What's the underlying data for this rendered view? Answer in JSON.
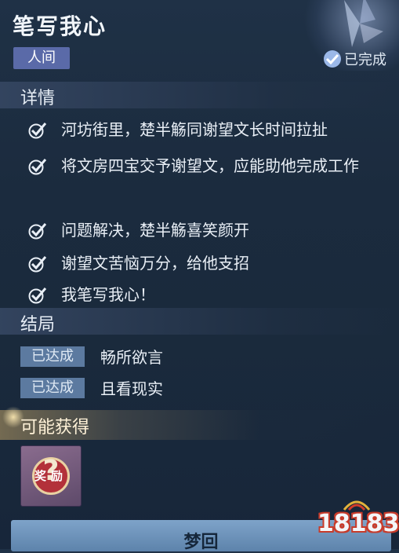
{
  "header": {
    "title": "笔写我心",
    "tag": "人间",
    "status": "已完成"
  },
  "details": {
    "heading": "详情",
    "items": [
      "河坊街里，楚半觞同谢望文长时间拉扯",
      "将文房四宝交予谢望文，应能助他完成工作",
      "问题解决，楚半觞喜笑颜开",
      "谢望文苦恼万分，给他支招",
      "我笔写我心！"
    ]
  },
  "endings": {
    "heading": "结局",
    "items": [
      {
        "badge": "已达成",
        "label": "畅所欲言"
      },
      {
        "badge": "已达成",
        "label": "且看现实"
      }
    ]
  },
  "rewards": {
    "heading": "可能获得",
    "item_label": "奖励",
    "item_icon": "question-mark"
  },
  "footer_button": "梦回",
  "watermark": "18183",
  "colors": {
    "tag_bg": "#5a6aa8",
    "badge_bg": "#5c7aa0",
    "check": "#e9eff6",
    "button_bg": "#6f95bd"
  }
}
